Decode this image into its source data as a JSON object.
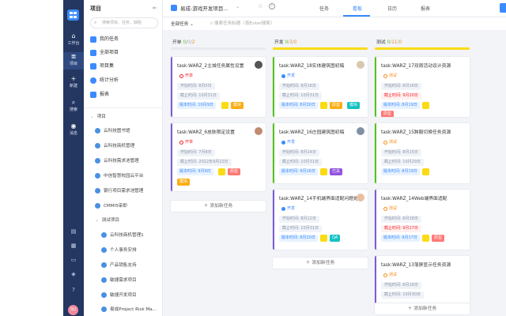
{
  "rail": {
    "items": [
      {
        "label": "工作台",
        "icon": "home-icon"
      },
      {
        "label": "项目",
        "icon": "layers-icon"
      },
      {
        "label": "新建",
        "icon": "plus-icon"
      },
      {
        "label": "搜索",
        "icon": "search-icon"
      },
      {
        "label": "消息",
        "icon": "message-icon"
      }
    ],
    "avatar": "SU"
  },
  "sidebar": {
    "title": "项目",
    "search_placeholder": "搜索项目、任务、缺陷",
    "nav": [
      {
        "label": "我的任务"
      },
      {
        "label": "全部项目"
      },
      {
        "label": "项目集"
      },
      {
        "label": "统计分析"
      },
      {
        "label": "报表"
      }
    ],
    "tree_header": "项目",
    "projects": [
      {
        "label": "云科技图书馆",
        "indent": 0
      },
      {
        "label": "云科技商机管理",
        "indent": 0
      },
      {
        "label": "云科技需求池管理",
        "indent": 0
      },
      {
        "label": "中信智慧校园云平台",
        "indent": 0
      },
      {
        "label": "银行项目需求池管理",
        "indent": 0
      },
      {
        "label": "CMMI5审即",
        "indent": 0
      },
      {
        "label": "测试项目",
        "indent": 0,
        "group": true
      },
      {
        "label": "云科技商机管理1",
        "indent": 1
      },
      {
        "label": "个人事务安排",
        "indent": 1
      },
      {
        "label": "产品销售支持",
        "indent": 1
      },
      {
        "label": "敏捷需求项目",
        "indent": 1
      },
      {
        "label": "敏捷开发项目",
        "indent": 1
      },
      {
        "label": "易成Project Risk Ma...",
        "indent": 1
      }
    ]
  },
  "header": {
    "project_title": "易成-游戏开发项目...",
    "tabs": [
      {
        "label": "任务",
        "active": false
      },
      {
        "label": "看板",
        "active": true
      },
      {
        "label": "日历",
        "active": false
      },
      {
        "label": "报表",
        "active": false
      }
    ]
  },
  "filter": {
    "label": "全部任务",
    "search_placeholder": "搜索任务标题（按Enter搜索）"
  },
  "board": {
    "columns": [
      {
        "name": "开单",
        "counts": [
          "0",
          "0",
          "2"
        ],
        "bar_color": "#e6e9ef",
        "add_label": "添加新任务",
        "cards": [
          {
            "title": "task:WARZ_2主城任务属性设置",
            "status": "开单",
            "status_color": "#f5222d",
            "start": "开始时间: 8月5日",
            "end": "截止时间: 10月31日",
            "end_red": false,
            "version": "版本时间: 10月9日",
            "badges": [
              {
                "text": "模块",
                "color": "#faad14"
              }
            ],
            "accent": "#7b5cd6"
          },
          {
            "title": "task:WARZ_6皮肤限定设置",
            "status": "开单",
            "status_color": "#f5222d",
            "start": "开始时间: 7月8日",
            "end": "截止时间: 2022年9月22日",
            "end_red": false,
            "version": "版本时间: 9月9日",
            "badges": [
              {
                "text": "原型",
                "color": "#ff7875"
              },
              {
                "text": "模块",
                "color": "#faad14"
              }
            ],
            "accent": "#7b5cd6"
          }
        ]
      },
      {
        "name": "开发",
        "counts": [
          "0",
          "3",
          "0"
        ],
        "bar_color": "#fadb14",
        "add_label": "添加新任务",
        "cards": [
          {
            "title": "task:WARZ_18实体建筑图初稿",
            "status": "开发",
            "status_color": "#3b8bff",
            "start": "开始时间: 8月16日",
            "end": "截止时间: 10月31日",
            "end_red": false,
            "version": "版本时间: 8月30日",
            "badges": [
              {
                "text": "原型",
                "color": "#faad14"
              },
              {
                "text": "模块",
                "color": "#13c2c2"
              }
            ],
            "accent": "#52c41a"
          },
          {
            "title": "task:WARZ_16庄园建筑图初稿",
            "status": "开发",
            "status_color": "#3b8bff",
            "start": "开始时间: 8月14日",
            "end": "截止时间: 10月31日",
            "end_red": false,
            "version": "版本时间: 9月16日",
            "badges": [
              {
                "text": "已关",
                "color": "#9254de"
              }
            ],
            "accent": "#52c41a"
          },
          {
            "title": "task:WARZ_14手机端界面适配问题处理",
            "status": "开发",
            "status_color": "#3b8bff",
            "start": "开始时间: 8月12日",
            "end": "截止时间: 10月31日",
            "end_red": false,
            "version": "版本时间: 8月20日",
            "badges": [
              {
                "text": "QA",
                "color": "#13c2c2"
              }
            ],
            "accent": "#7b5cd6"
          }
        ]
      },
      {
        "name": "测试",
        "counts": [
          "0",
          "11",
          "0"
        ],
        "bar_color": "#fadb14",
        "add_label": "添加新任务",
        "cards": [
          {
            "title": "task:WARZ_17双周活动设计资源",
            "status": "测试",
            "status_color": "#fa8c16",
            "start": "开始时间: 8月16日",
            "end": "截止时间: 9月20日",
            "end_red": true,
            "version": "版本时间: 8月19日",
            "badges": [
              {
                "text": "原型",
                "color": "#ff7875"
              }
            ],
            "accent": "#52c41a"
          },
          {
            "title": "task:WARZ_15跨服切换任务资源",
            "status": "测试",
            "status_color": "#fa8c16",
            "start": "开始时间: 8月15日",
            "end": "截止时间: 10月29日",
            "end_red": false,
            "version": "版本时间: 8月19日",
            "badges": [],
            "accent": "#52c41a"
          },
          {
            "title": "task:WARZ_14Web端界面适配",
            "status": "测试",
            "status_color": "#fa8c16",
            "start": "开始时间: 8月18日",
            "end": "截止时间: 9月17日",
            "end_red": true,
            "version": "版本时间: 9月17日",
            "badges": [
              {
                "text": "原型",
                "color": "#ff7875"
              }
            ],
            "accent": "#7b5cd6"
          },
          {
            "title": "task:WARZ_13落屏显示任务资源",
            "status": "测试",
            "status_color": "#fa8c16",
            "start": "开始时间: 8月16日",
            "end": "截止时间: 10月30日",
            "end_red": false,
            "version": "",
            "badges": [],
            "accent": "#7b5cd6"
          }
        ]
      }
    ]
  }
}
